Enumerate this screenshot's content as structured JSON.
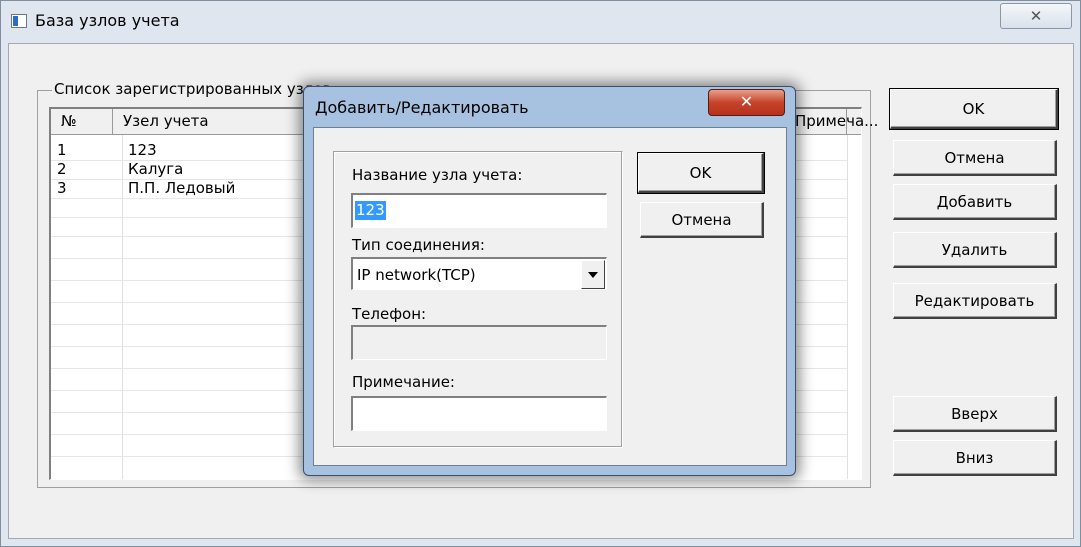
{
  "main_window": {
    "title": "База узлов учета",
    "close_glyph": "✕",
    "group_label": "Список зарегистрированных узлов",
    "columns": [
      "№",
      "Узел учета",
      "Примеча..."
    ],
    "rows": [
      {
        "num": "1",
        "name": "123"
      },
      {
        "num": "2",
        "name": "Калуга"
      },
      {
        "num": "3",
        "name": "П.П. Ледовый"
      }
    ],
    "buttons": {
      "ok": "OK",
      "cancel": "Отмена",
      "add": "Добавить",
      "delete": "Удалить",
      "edit": "Редактировать",
      "up": "Вверх",
      "down": "Вниз"
    }
  },
  "dialog": {
    "title": "Добавить/Редактировать",
    "close_glyph": "✕",
    "name_label": "Название узла учета:",
    "name_value": "123",
    "connection_label": "Тип соединения:",
    "connection_value": "IP network(TCP)",
    "phone_label": "Телефон:",
    "phone_value": "",
    "note_label": "Примечание:",
    "note_value": "",
    "ok": "OK",
    "cancel": "Отмена"
  },
  "colors": {
    "selection": "#3399ff",
    "dialog_frame": "#a7c2e0",
    "close_button": "#c6432b"
  }
}
